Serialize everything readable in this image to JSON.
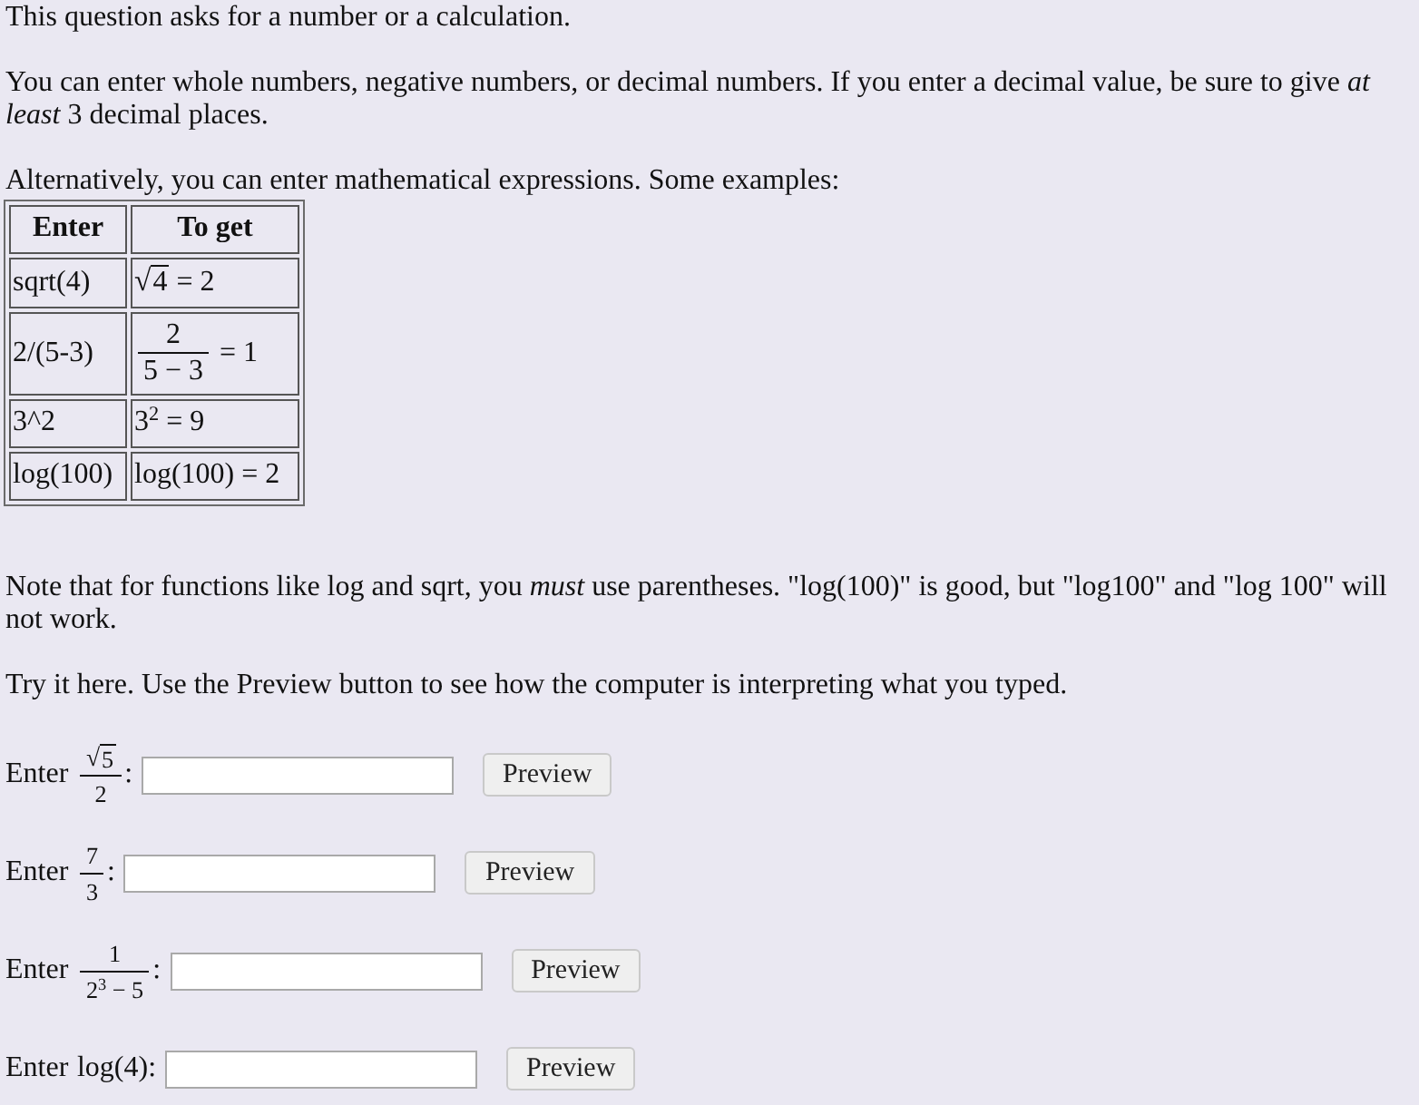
{
  "intro": [
    "This question asks for a number or a calculation.",
    "You can enter whole numbers, negative numbers, or decimal numbers. If you enter a decimal value, be sure to give *at least* 3 decimal places.",
    "Alternatively, you can enter mathematical expressions. Some examples:"
  ],
  "examples_table": {
    "columns": [
      "Enter",
      "To get"
    ],
    "rows": [
      {
        "enter": "sqrt(4)",
        "to_get": [
          {
            "kind": "radical",
            "sign": "√",
            "body": "4"
          },
          {
            "kind": "text",
            "text": "= 2"
          }
        ]
      },
      {
        "enter": "2/(5-3)",
        "to_get": [
          {
            "kind": "frac",
            "num": [
              {
                "kind": "text",
                "text": "2"
              }
            ],
            "den": [
              {
                "kind": "text",
                "text": "5 − 3"
              }
            ]
          },
          {
            "kind": "text",
            "text": "= 1"
          }
        ]
      },
      {
        "enter": "3^2",
        "to_get": [
          {
            "kind": "text",
            "text": "3$^{2}$ = 9"
          }
        ]
      },
      {
        "enter": "log(100)",
        "to_get": [
          {
            "kind": "text",
            "text": "log(100) = 2"
          }
        ]
      }
    ]
  },
  "notes": [
    "Note that for functions like log and sqrt, you *must* use parentheses. \"log(100)\" is good, but \"log100\" and \"log 100\" will not work.",
    "Try it here. Use the Preview button to see how the computer is interpreting what you typed."
  ],
  "try_rows": [
    {
      "label": "Enter",
      "expression": [
        {
          "kind": "frac",
          "num": [
            {
              "kind": "radical",
              "sign": "√",
              "body": "5"
            }
          ],
          "den": [
            {
              "kind": "text",
              "text": "2"
            }
          ]
        }
      ],
      "suffix": ":",
      "button": "Preview"
    },
    {
      "label": "Enter",
      "expression": [
        {
          "kind": "frac",
          "num": [
            {
              "kind": "text",
              "text": "7"
            }
          ],
          "den": [
            {
              "kind": "text",
              "text": "3"
            }
          ]
        }
      ],
      "suffix": ":",
      "button": "Preview"
    },
    {
      "label": "Enter",
      "expression": [
        {
          "kind": "frac",
          "num": [
            {
              "kind": "text",
              "text": "1"
            }
          ],
          "den": [
            {
              "kind": "text",
              "text": "2$^{3}$ − 5"
            }
          ]
        }
      ],
      "suffix": ":",
      "button": "Preview"
    },
    {
      "label": "Enter",
      "expression": [
        {
          "kind": "text",
          "text": "log(4)"
        }
      ],
      "suffix": ":",
      "button": "Preview"
    }
  ]
}
